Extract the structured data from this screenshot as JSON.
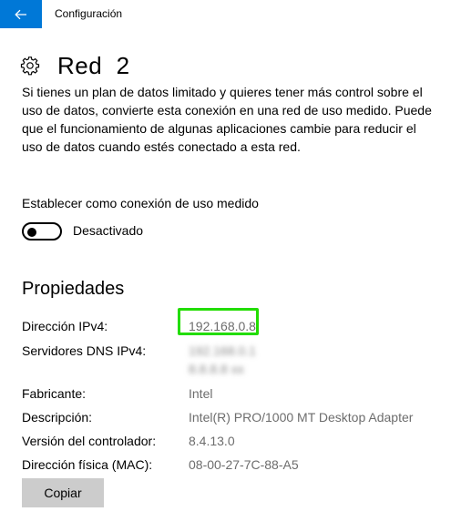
{
  "window": {
    "title": "Configuración"
  },
  "page": {
    "title": "Red  2"
  },
  "metered": {
    "description": "Si tienes un plan de datos limitado y quieres tener más control sobre el uso de datos, convierte esta conexión en una red de uso medido. Puede que el funcionamiento de algunas aplicaciones cambie para reducir el uso de datos cuando estés conectado a esta red.",
    "label": "Establecer como conexión de uso medido",
    "toggle_state": "Desactivado",
    "toggle_on": false
  },
  "properties": {
    "title": "Propiedades",
    "ipv4_label": "Dirección IPv4:",
    "ipv4_value": "192.168.0.8",
    "dns_label": "Servidores DNS IPv4:",
    "dns_values": [
      "192.168.0.1",
      "8.8.8.8 xx"
    ],
    "manufacturer_label": "Fabricante:",
    "manufacturer_value": "Intel",
    "description_label": "Descripción:",
    "description_value": "Intel(R) PRO/1000 MT Desktop Adapter",
    "driver_label": "Versión del controlador:",
    "driver_value": "8.4.13.0",
    "mac_label": "Dirección física (MAC):",
    "mac_value": "08-00-27-7C-88-A5"
  },
  "actions": {
    "copy_label": "Copiar"
  },
  "colors": {
    "accent": "#0078d7",
    "highlight": "#22dd00",
    "button_bg": "#cccccc"
  },
  "icons": {
    "back": "back-arrow-icon",
    "settings": "gear-icon"
  }
}
